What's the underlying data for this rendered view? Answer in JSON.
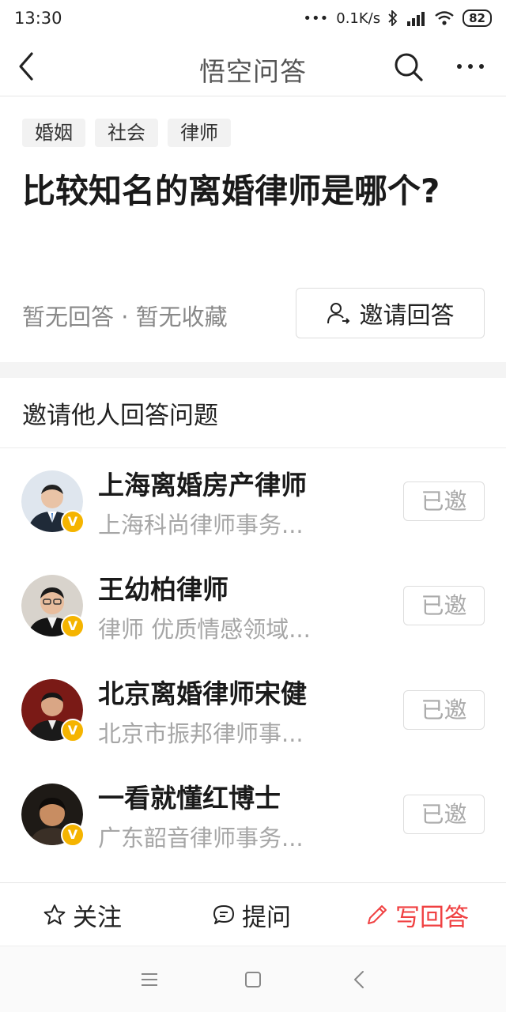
{
  "status_bar": {
    "time": "13:30",
    "network_speed": "0.1K/s",
    "battery": "82",
    "icons": [
      "bluetooth-icon",
      "signal-icon",
      "wifi-icon",
      "battery-icon"
    ]
  },
  "nav": {
    "title": "悟空问答",
    "icons": [
      "back-icon",
      "search-icon",
      "more-icon"
    ]
  },
  "tags": [
    "婚姻",
    "社会",
    "律师"
  ],
  "question": {
    "title": "比较知名的离婚律师是哪个?",
    "stats": "暂无回答 · 暂无收藏",
    "invite_label": "邀请回答"
  },
  "invite_section": {
    "title": "邀请他人回答问题",
    "items": [
      {
        "name": "上海离婚房产律师",
        "desc": "上海科尚律师事务...",
        "status": "已邀",
        "verified": "V"
      },
      {
        "name": "王幼柏律师",
        "desc": "律师 优质情感领域...",
        "status": "已邀",
        "verified": "V"
      },
      {
        "name": "北京离婚律师宋健",
        "desc": "北京市振邦律师事...",
        "status": "已邀",
        "verified": "V"
      },
      {
        "name": "一看就懂红博士",
        "desc": "广东韶音律师事务...",
        "status": "已邀",
        "verified": "V"
      }
    ]
  },
  "action_bar": {
    "follow": "关注",
    "ask": "提问",
    "write": "写回答"
  },
  "colors": {
    "accent": "#f04142",
    "verified_badge": "#f5b400",
    "muted_text": "#a6a6a6"
  }
}
